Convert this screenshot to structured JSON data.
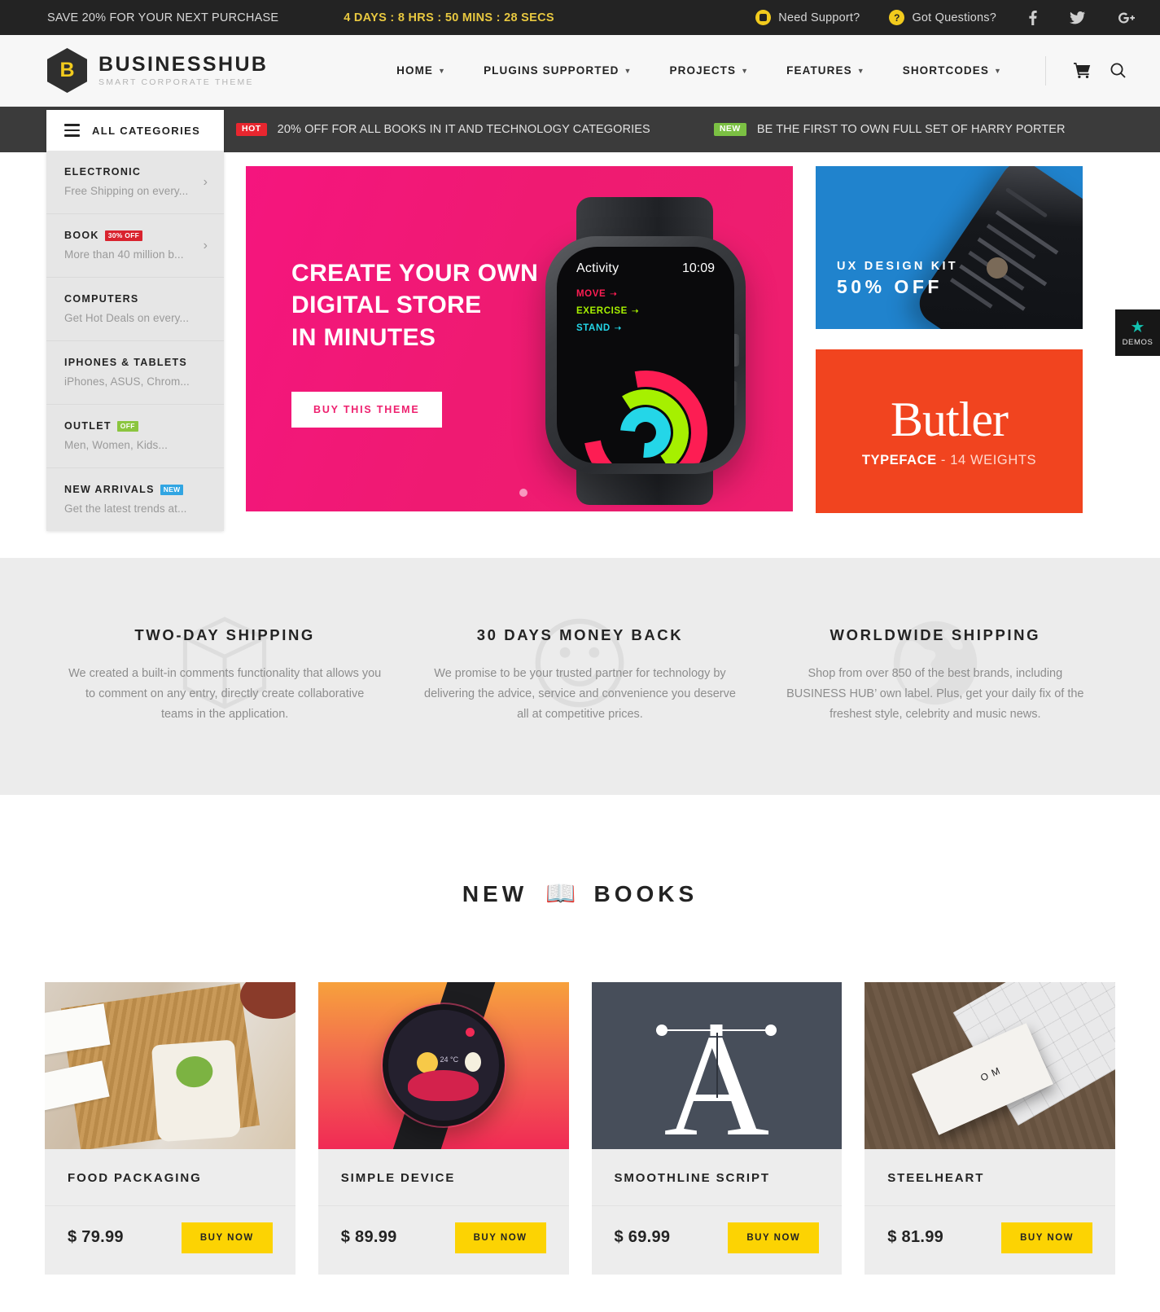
{
  "topbar": {
    "save_text": "SAVE 20% FOR YOUR NEXT PURCHASE",
    "countdown": "4 DAYS : 8 HRS : 50 MINS : 28 SECS",
    "support_label": "Need Support?",
    "questions_label": "Got Questions?",
    "socials": [
      {
        "name": "facebook-icon"
      },
      {
        "name": "twitter-icon"
      },
      {
        "name": "google-plus-icon"
      }
    ],
    "accent_yellow": "#f2cb1d",
    "background": "#232323"
  },
  "header": {
    "logo_letter": "B",
    "brand_name": "BUSINESSHUB",
    "brand_tagline": "SMART CORPORATE THEME",
    "nav": [
      {
        "label": "HOME",
        "has_caret": true
      },
      {
        "label": "PLUGINS SUPPORTED",
        "has_caret": true
      },
      {
        "label": "PROJECTS",
        "has_caret": true
      },
      {
        "label": "FEATURES",
        "has_caret": true
      },
      {
        "label": "SHORTCODES",
        "has_caret": true
      }
    ],
    "cart_icon": "cart-icon",
    "search_icon": "search-icon"
  },
  "categories": {
    "header_label": "ALL CATEGORIES",
    "items": [
      {
        "title": "ELECTRONIC",
        "badge": null,
        "badge_color": null,
        "subtitle": "Free Shipping on every...",
        "arrow": true
      },
      {
        "title": "BOOK",
        "badge": "30% OFF",
        "badge_color": "#d9232e",
        "subtitle": "More than 40 million b...",
        "arrow": true
      },
      {
        "title": "COMPUTERS",
        "badge": null,
        "badge_color": null,
        "subtitle": "Get Hot Deals on every...",
        "arrow": false
      },
      {
        "title": "IPHONES & TABLETS",
        "badge": null,
        "badge_color": null,
        "subtitle": "iPhones, ASUS, Chrom...",
        "arrow": false
      },
      {
        "title": "OUTLET",
        "badge": "OFF",
        "badge_color": "#8bc53f",
        "subtitle": "Men, Women, Kids...",
        "arrow": false
      },
      {
        "title": "NEW ARRIVALS",
        "badge": "NEW",
        "badge_color": "#31a5e2",
        "subtitle": "Get the latest trends at...",
        "arrow": false
      }
    ]
  },
  "promos": [
    {
      "tag": "HOT",
      "tag_type": "hot",
      "text": "20% OFF FOR ALL BOOKS IN IT AND TECHNOLOGY CATEGORIES"
    },
    {
      "tag": "NEW",
      "tag_type": "new",
      "text": "BE THE FIRST TO OWN FULL SET OF HARRY PORTER"
    }
  ],
  "hero": {
    "line1": "CREATE YOUR OWN",
    "line2": "DIGITAL STORE",
    "line3": "IN MINUTES",
    "button": "BUY THIS THEME",
    "background_color": "#ee1f6e",
    "watch": {
      "activity_label": "Activity",
      "time": "10:09",
      "move": "MOVE",
      "exercise": "EXERCISE",
      "stand": "STAND"
    }
  },
  "side_banners": {
    "ux": {
      "line1": "UX DESIGN KIT",
      "line2": "50% OFF",
      "background_color": "#2083cd"
    },
    "butler": {
      "word": "Butler",
      "sub_bold": "TYPEFACE",
      "sub_rest": " - 14 WEIGHTS",
      "background_color": "#f1441f"
    }
  },
  "demos_tab": {
    "label": "DEMOS",
    "icon": "star-icon",
    "star_color": "#12c2b0"
  },
  "features": [
    {
      "icon": "box-icon",
      "title": "TWO-DAY SHIPPING",
      "text": "We created a built-in comments functionality that allows you to comment on any entry, directly create collaborative teams in the application."
    },
    {
      "icon": "smiley-icon",
      "title": "30 DAYS MONEY BACK",
      "text": "We promise to be your trusted partner for technology by delivering the advice, service and convenience you deserve all at competitive prices."
    },
    {
      "icon": "globe-icon",
      "title": "WORLDWIDE SHIPPING",
      "text": "Shop from over 850 of the best brands, including BUSINESS HUB’ own label. Plus, get your daily fix of the freshest style, celebrity and music news."
    }
  ],
  "new_books": {
    "title_left": "NEW",
    "title_icon": "open-book-icon",
    "title_right": "BOOKS",
    "products": [
      {
        "title": "FOOD PACKAGING",
        "price": "$ 79.99",
        "buy_label": "BUY NOW",
        "art": "food"
      },
      {
        "title": "SIMPLE DEVICE",
        "price": "$ 89.99",
        "buy_label": "BUY NOW",
        "art": "watch"
      },
      {
        "title": "SMOOTHLINE SCRIPT",
        "price": "$ 69.99",
        "buy_label": "BUY NOW",
        "art": "type"
      },
      {
        "title": "STEELHEART",
        "price": "$ 81.99",
        "buy_label": "BUY NOW",
        "art": "cards"
      }
    ]
  },
  "colors": {
    "yellow_button": "#fcd303",
    "dark": "#232323",
    "pink": "#ee1f6e"
  }
}
